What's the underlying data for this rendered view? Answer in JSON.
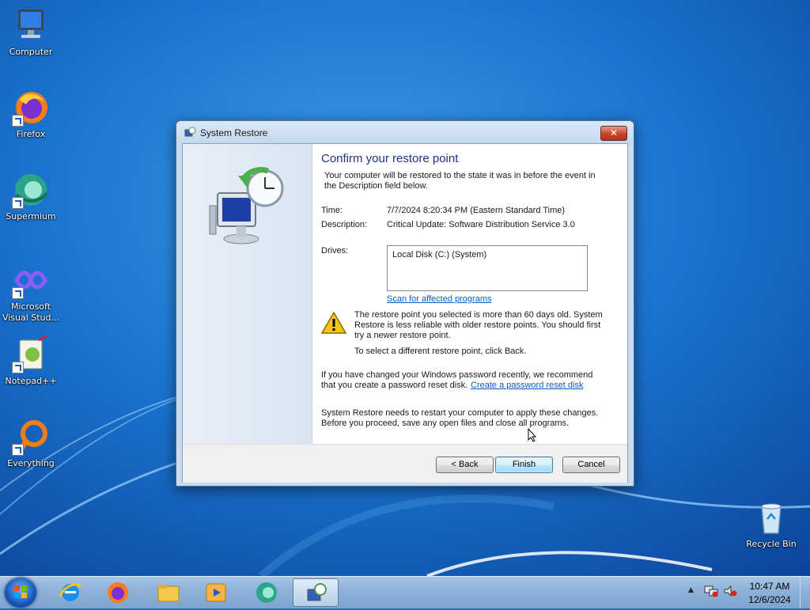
{
  "desktop": {
    "icons": [
      {
        "label": "Computer",
        "icon": "computer-icon"
      },
      {
        "label": "Firefox",
        "icon": "firefox-icon"
      },
      {
        "label": "Supermium",
        "icon": "supermium-icon"
      },
      {
        "label": "Microsoft Visual Stud...",
        "icon": "visual-studio-icon"
      },
      {
        "label": "Notepad++",
        "icon": "notepadpp-icon"
      },
      {
        "label": "Everything",
        "icon": "everything-icon"
      },
      {
        "label": "Recycle Bin",
        "icon": "recycle-bin-icon"
      }
    ]
  },
  "dialog": {
    "title": "System Restore",
    "close_glyph": "✕",
    "heading": "Confirm your restore point",
    "intro": "Your computer will be restored to the state it was in before the event in the Description field below.",
    "time_label": "Time:",
    "time_value": "7/7/2024 8:20:34 PM (Eastern Standard Time)",
    "description_label": "Description:",
    "description_value": "Critical Update: Software Distribution Service 3.0",
    "drives_label": "Drives:",
    "drives": [
      "Local Disk (C:) (System)"
    ],
    "scan_link": "Scan for affected programs",
    "warning_text": "The restore point you selected is more than 60 days old. System Restore is less reliable with older restore points. You should first try a newer restore point.",
    "warning_back": "To select a different restore point, click Back.",
    "password_text": "If you have changed your Windows password recently, we recommend that you create a password reset disk.",
    "password_link": "Create a password reset disk",
    "restart_text": "System Restore needs to restart your computer to apply these changes. Before you proceed, save any open files and close all programs.",
    "buttons": {
      "back": "< Back",
      "finish": "Finish",
      "cancel": "Cancel"
    }
  },
  "taskbar": {
    "apps": [
      "internet-explorer-icon",
      "firefox-icon",
      "file-explorer-icon",
      "media-player-icon",
      "supermium-icon",
      "system-restore-icon"
    ],
    "time": "10:47 AM",
    "date": "12/6/2024",
    "tray_up": "▲"
  },
  "colors": {
    "desktop_blue": "#1b6fc9",
    "heading_blue": "#1e3287",
    "link_blue": "#0a5cbf"
  }
}
